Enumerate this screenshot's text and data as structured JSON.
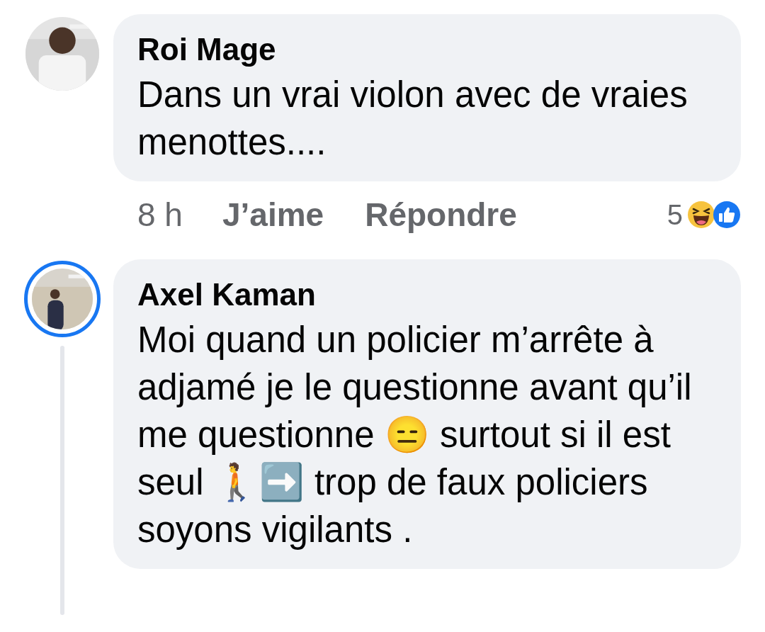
{
  "comments": [
    {
      "author": "Roi Mage",
      "text": "Dans un vrai violon avec de vraies menottes....",
      "has_story": false,
      "has_replies": false,
      "actions": {
        "time": "8 h",
        "like": "J’aime",
        "reply": "Répondre",
        "reaction_count": "5",
        "reactions": [
          {
            "kind": "haha"
          },
          {
            "kind": "like"
          }
        ]
      }
    },
    {
      "author": "Axel Kaman",
      "text": "Moi quand un policier m’arrête à adjamé je le questionne avant qu’il me questionne 😑 surtout si il est seul 🚶➡️ trop de faux policiers soyons vigilants .",
      "has_story": true,
      "has_replies": true
    }
  ]
}
